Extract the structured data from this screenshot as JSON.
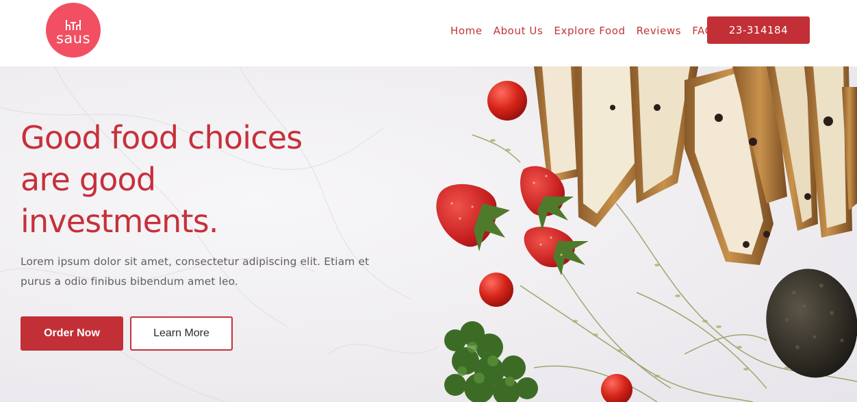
{
  "header": {
    "logo_text": "saus",
    "nav": [
      "Home",
      "About Us",
      "Explore Food",
      "Reviews",
      "FAQ"
    ],
    "phone": "23-314184"
  },
  "hero": {
    "headline": [
      "Good food choices",
      "are good",
      "investments."
    ],
    "subtext": [
      "Lorem ipsum dolor sit amet, consectetur adipiscing elit. Etiam et",
      "purus a odio finibus bibendum amet leo."
    ],
    "order_button": "Order Now",
    "learn_button": "Learn More"
  },
  "colors": {
    "brand_red": "#c32f36",
    "logo_pink": "#f24f62",
    "text_gray": "#5f5d66",
    "background": "#efedf0"
  },
  "icons": {
    "logo": "restaurant-table-icon"
  }
}
